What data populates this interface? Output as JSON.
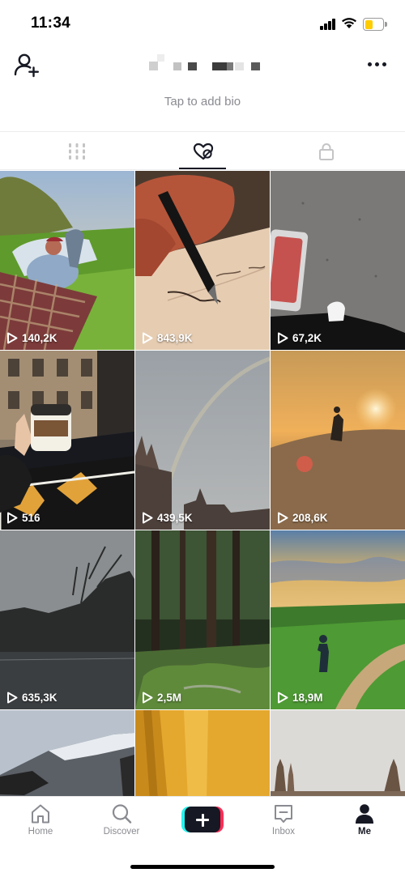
{
  "status_bar": {
    "time": "11:34",
    "icons": [
      "cellular-signal-icon",
      "wifi-icon",
      "battery-icon"
    ],
    "battery_color": "#ffcc00"
  },
  "profile": {
    "add_friend_icon": "person-add-icon",
    "more_icon": "ellipsis-icon",
    "bio_placeholder": "Tap to add bio"
  },
  "tabs": [
    {
      "icon": "grid-icon",
      "active": false
    },
    {
      "icon": "liked-heart-icon",
      "active": true
    },
    {
      "icon": "lock-icon",
      "active": false
    }
  ],
  "videos": [
    {
      "views": "140,2K"
    },
    {
      "views": "843,9K"
    },
    {
      "views": "67,2K"
    },
    {
      "views": "516"
    },
    {
      "views": "439,5K"
    },
    {
      "views": "208,6K"
    },
    {
      "views": "635,3K"
    },
    {
      "views": "2,5M"
    },
    {
      "views": "18,9M"
    },
    {
      "views": ""
    },
    {
      "views": ""
    },
    {
      "views": ""
    }
  ],
  "bottom_nav": {
    "home": "Home",
    "discover": "Discover",
    "inbox": "Inbox",
    "me": "Me",
    "active": "me",
    "create_colors": {
      "left": "#25f4ee",
      "right": "#fe2c55",
      "center": "#161823"
    }
  }
}
